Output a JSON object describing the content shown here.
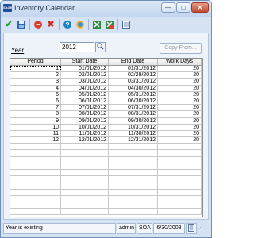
{
  "window": {
    "app_icon_text": "SAGE",
    "title": "Inventory Calendar",
    "controls": {
      "minimize": "—",
      "maximize": "□",
      "close": "✕"
    }
  },
  "toolbar": {
    "icons": [
      "accept-icon",
      "save-icon",
      "delete-icon",
      "cancel-icon",
      "help-icon",
      "globe-icon",
      "export-icon",
      "spreadsheet-icon",
      "memo-icon"
    ]
  },
  "form": {
    "year_label": "Year",
    "year_value": "2012",
    "copy_button": "Copy From..."
  },
  "grid": {
    "headers": [
      "Period",
      "Start Date",
      "End Date",
      "Work Days"
    ],
    "rows": [
      [
        "1",
        "01/01/2012",
        "01/31/2012",
        "20"
      ],
      [
        "2",
        "02/01/2012",
        "02/29/2012",
        "20"
      ],
      [
        "3",
        "03/01/2012",
        "03/31/2012",
        "20"
      ],
      [
        "4",
        "04/01/2012",
        "04/30/2012",
        "20"
      ],
      [
        "5",
        "05/01/2012",
        "05/31/2012",
        "20"
      ],
      [
        "6",
        "06/01/2012",
        "06/30/2012",
        "20"
      ],
      [
        "7",
        "07/01/2012",
        "07/31/2012",
        "20"
      ],
      [
        "8",
        "08/01/2012",
        "08/31/2012",
        "20"
      ],
      [
        "9",
        "09/01/2012",
        "09/30/2012",
        "20"
      ],
      [
        "10",
        "10/01/2012",
        "10/31/2012",
        "20"
      ],
      [
        "11",
        "11/01/2012",
        "11/30/2012",
        "20"
      ],
      [
        "12",
        "12/01/2012",
        "12/31/2012",
        "20"
      ]
    ],
    "empty_rows": 11
  },
  "status": {
    "message": "Year is existing",
    "user": "admin",
    "company": "SOA",
    "date": "6/30/2008"
  }
}
